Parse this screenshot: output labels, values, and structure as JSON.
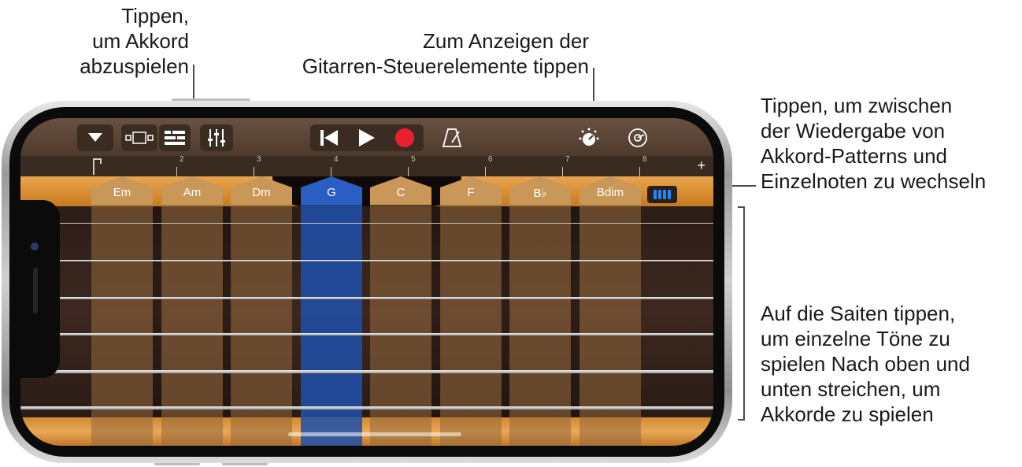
{
  "callouts": {
    "play_chord": [
      "Tippen,",
      "um Akkord",
      "abzuspielen"
    ],
    "guitar_controls": [
      "Zum Anzeigen der",
      "Gitarren-Steuerelemente tippen"
    ],
    "toggle_mode": [
      "Tippen, um zwischen",
      "der Wiedergabe von",
      "Akkord-Patterns und",
      "Einzelnoten zu wechseln"
    ],
    "strings": [
      "Auf die Saiten tippen,",
      "um einzelne Töne zu",
      "spielen Nach oben und",
      "unten streichen, um",
      "Akkorde zu spielen"
    ]
  },
  "toolbar": {
    "icons": [
      "dropdown-icon",
      "view-switch-icon",
      "tracks-icon",
      "mixer-icon",
      "rewind-icon",
      "play-icon",
      "record-icon",
      "metronome-icon",
      "guitar-controls-icon",
      "settings-icon"
    ]
  },
  "ruler": {
    "bars": [
      "2",
      "3",
      "4",
      "5",
      "6",
      "7",
      "8"
    ],
    "add_label": "+"
  },
  "chords": [
    {
      "label": "Em",
      "active": false
    },
    {
      "label": "Am",
      "active": false
    },
    {
      "label": "Dm",
      "active": false
    },
    {
      "label": "G",
      "active": true
    },
    {
      "label": "C",
      "active": false
    },
    {
      "label": "F",
      "active": false
    },
    {
      "label": "B♭",
      "active": false
    },
    {
      "label": "Bdim",
      "active": false
    }
  ],
  "colors": {
    "record": "#e8212f",
    "accent_blue": "#1e88ff",
    "active_chord": "#2b5ec2"
  }
}
